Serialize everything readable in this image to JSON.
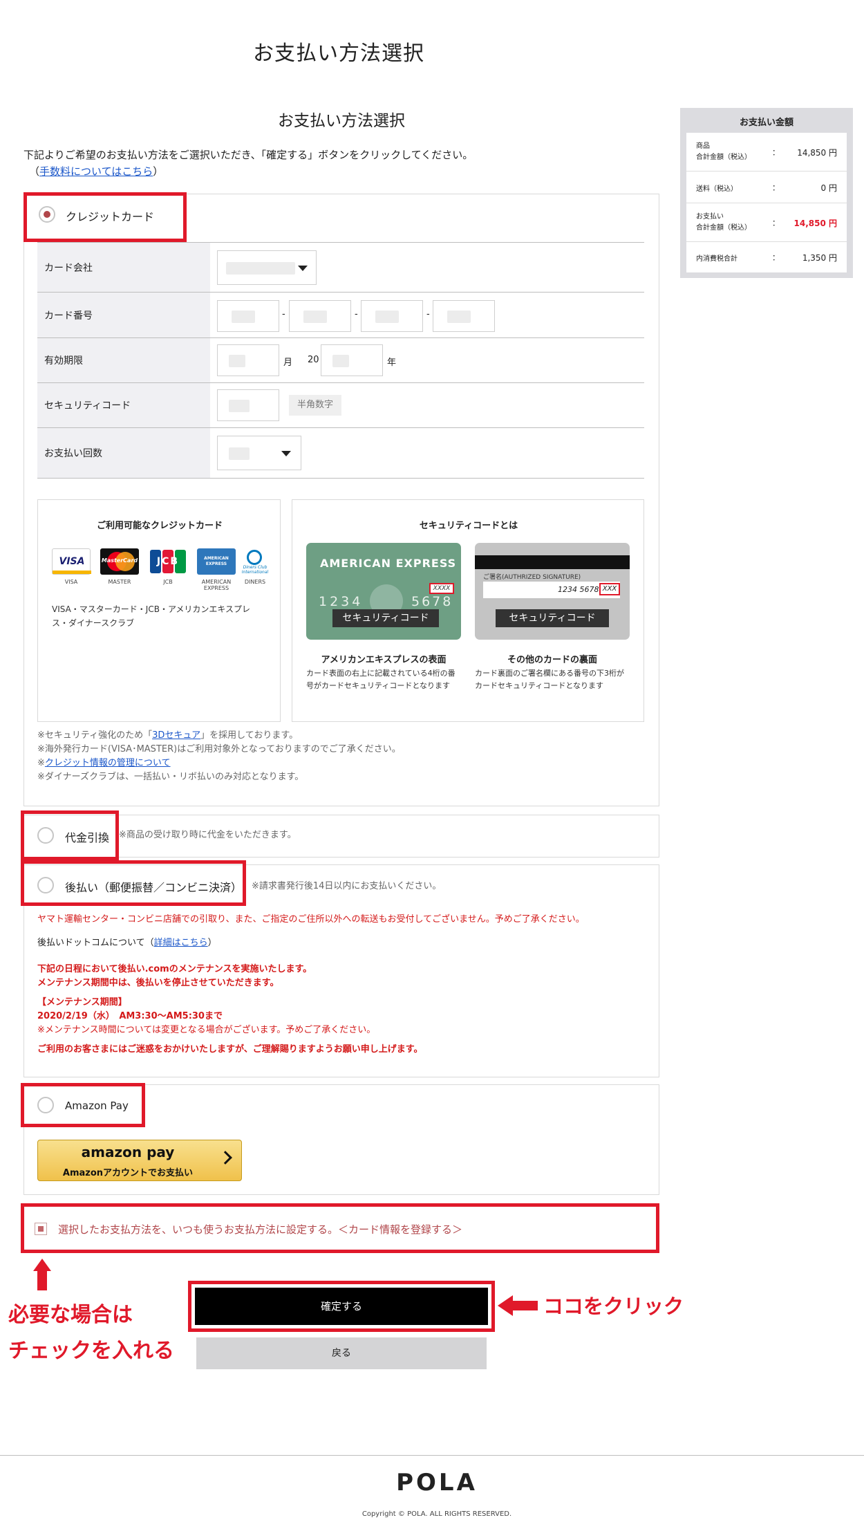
{
  "page": {
    "title": "お支払い方法選択"
  },
  "section": {
    "title": "お支払い方法選択",
    "intro": "下記よりご希望のお支払い方法をご選択いただき、「確定する」ボタンをクリックしてください。",
    "fee_link": "手数料についてはこちら"
  },
  "credit": {
    "label": "クレジットカード",
    "rows": [
      {
        "label": "カード会社"
      },
      {
        "label": "カード番号"
      },
      {
        "label": "有効期限",
        "month_unit": "月",
        "year_prefix": "20",
        "year_unit": "年"
      },
      {
        "label": "セキュリティコード",
        "hint": "半角数字"
      },
      {
        "label": "お支払い回数"
      }
    ],
    "available_title": "ご利用可能なクレジットカード",
    "brands": [
      {
        "name": "VISA",
        "caption": "VISA",
        "color": "#1a1f71"
      },
      {
        "name": "MasterCard",
        "caption": "MASTER",
        "color": "#eb001b"
      },
      {
        "name": "JCB",
        "caption": "JCB",
        "color": "#0e4c96"
      },
      {
        "name": "AMERICAN EXPRESS",
        "caption": "AMERICAN EXPRESS",
        "color": "#2e77bb"
      },
      {
        "name": "Diners Club International",
        "caption": "DINERS",
        "color": "#ffffff"
      }
    ],
    "brands_text": "VISA・マスターカード・JCB・アメリカンエキスプレス・ダイナースクラブ",
    "security_title": "セキュリティコードとは",
    "amex_card_text": "AMERICAN EXPRESS",
    "amex_number": "1234",
    "amex_number_right": "5678",
    "amex_code": "XXXX",
    "card_badge": "セキュリティコード",
    "other_signature": "ご署名(AUTHRIZED SIGNATURE)",
    "other_number": "1234 5678",
    "other_code": "XXX",
    "amex_caption": "アメリカンエキスプレスの表面",
    "amex_desc": "カード表面の右上に記載されている4桁の番号がカードセキュリティコードとなります",
    "other_caption": "その他のカードの裏面",
    "other_desc": "カード裏面のご署名欄にある番号の下3桁がカードセキュリティコードとなります",
    "notes_1a": "※セキュリティ強化のため「",
    "notes_1link": "3Dセキュア",
    "notes_1b": "」を採用しております。",
    "notes_2": "※海外発行カード(VISA･MASTER)はご利用対象外となっておりますのでご了承ください。",
    "notes_3a": "※",
    "notes_3link": "クレジット情報の管理について",
    "notes_4": "※ダイナーズクラブは、一括払い・リボ払いのみ対応となります。"
  },
  "cod": {
    "label": "代金引換",
    "desc": "※商品の受け取り時に代金をいただきます。"
  },
  "deferred": {
    "label": "後払い（郵便振替／コンビニ決済）",
    "desc": "※請求書発行後14日以内にお支払いください。",
    "warning": "ヤマト運輸センター・コンビニ店舗での引取り、また、ご指定のご住所以外への転送もお受付してございません。予めご了承ください。",
    "about_a": "後払いドットコムについて（",
    "about_link": "詳細はこちら",
    "about_b": "）",
    "m1": "下記の日程において後払い.comのメンテナンスを実施いたします。",
    "m2": "メンテナンス期間中は、後払いを停止させていただきます。",
    "m3": "【メンテナンス期間】",
    "m4": "2020/2/19（水）　AM3:30～AM5:30まで",
    "m5": "※メンテナンス時間については変更となる場合がございます。予めご了承ください。",
    "m6": "ご利用のお客さまにはご迷惑をおかけいたしますが、ご理解賜りますようお願い申し上げます。"
  },
  "amazon": {
    "label": "Amazon Pay",
    "btn_logo": "amazon pay",
    "btn_text": "Amazonアカウントでお支払い"
  },
  "default_check": {
    "label": "選択したお支払方法を、いつも使うお支払方法に設定する。",
    "link": "＜カード情報を登録する＞"
  },
  "buttons": {
    "confirm": "確定する",
    "back": "戻る"
  },
  "annotations": {
    "left1": "必要な場合は",
    "left2": "チェックを入れる",
    "right": "ココをクリック"
  },
  "summary": {
    "title": "お支払い金額",
    "rows": [
      {
        "label": "商品\n合計金額（税込）",
        "colon": "：",
        "value": "14,850 円",
        "red": false
      },
      {
        "label": "送料（税込）",
        "colon": "：",
        "value": "0 円",
        "red": false
      },
      {
        "label": "お支払い\n合計金額（税込）",
        "colon": "：",
        "value": "14,850 円",
        "red": true
      },
      {
        "label": "内消費税合計",
        "colon": "：",
        "value": "1,350 円",
        "red": false
      }
    ]
  },
  "footer": {
    "logo": "POLA",
    "copyright": "Copyright © POLA. ALL RIGHTS RESERVED."
  },
  "colors": {
    "annotation": "#e0192a",
    "accent": "#b1464a",
    "price_red": "#e0192a"
  }
}
